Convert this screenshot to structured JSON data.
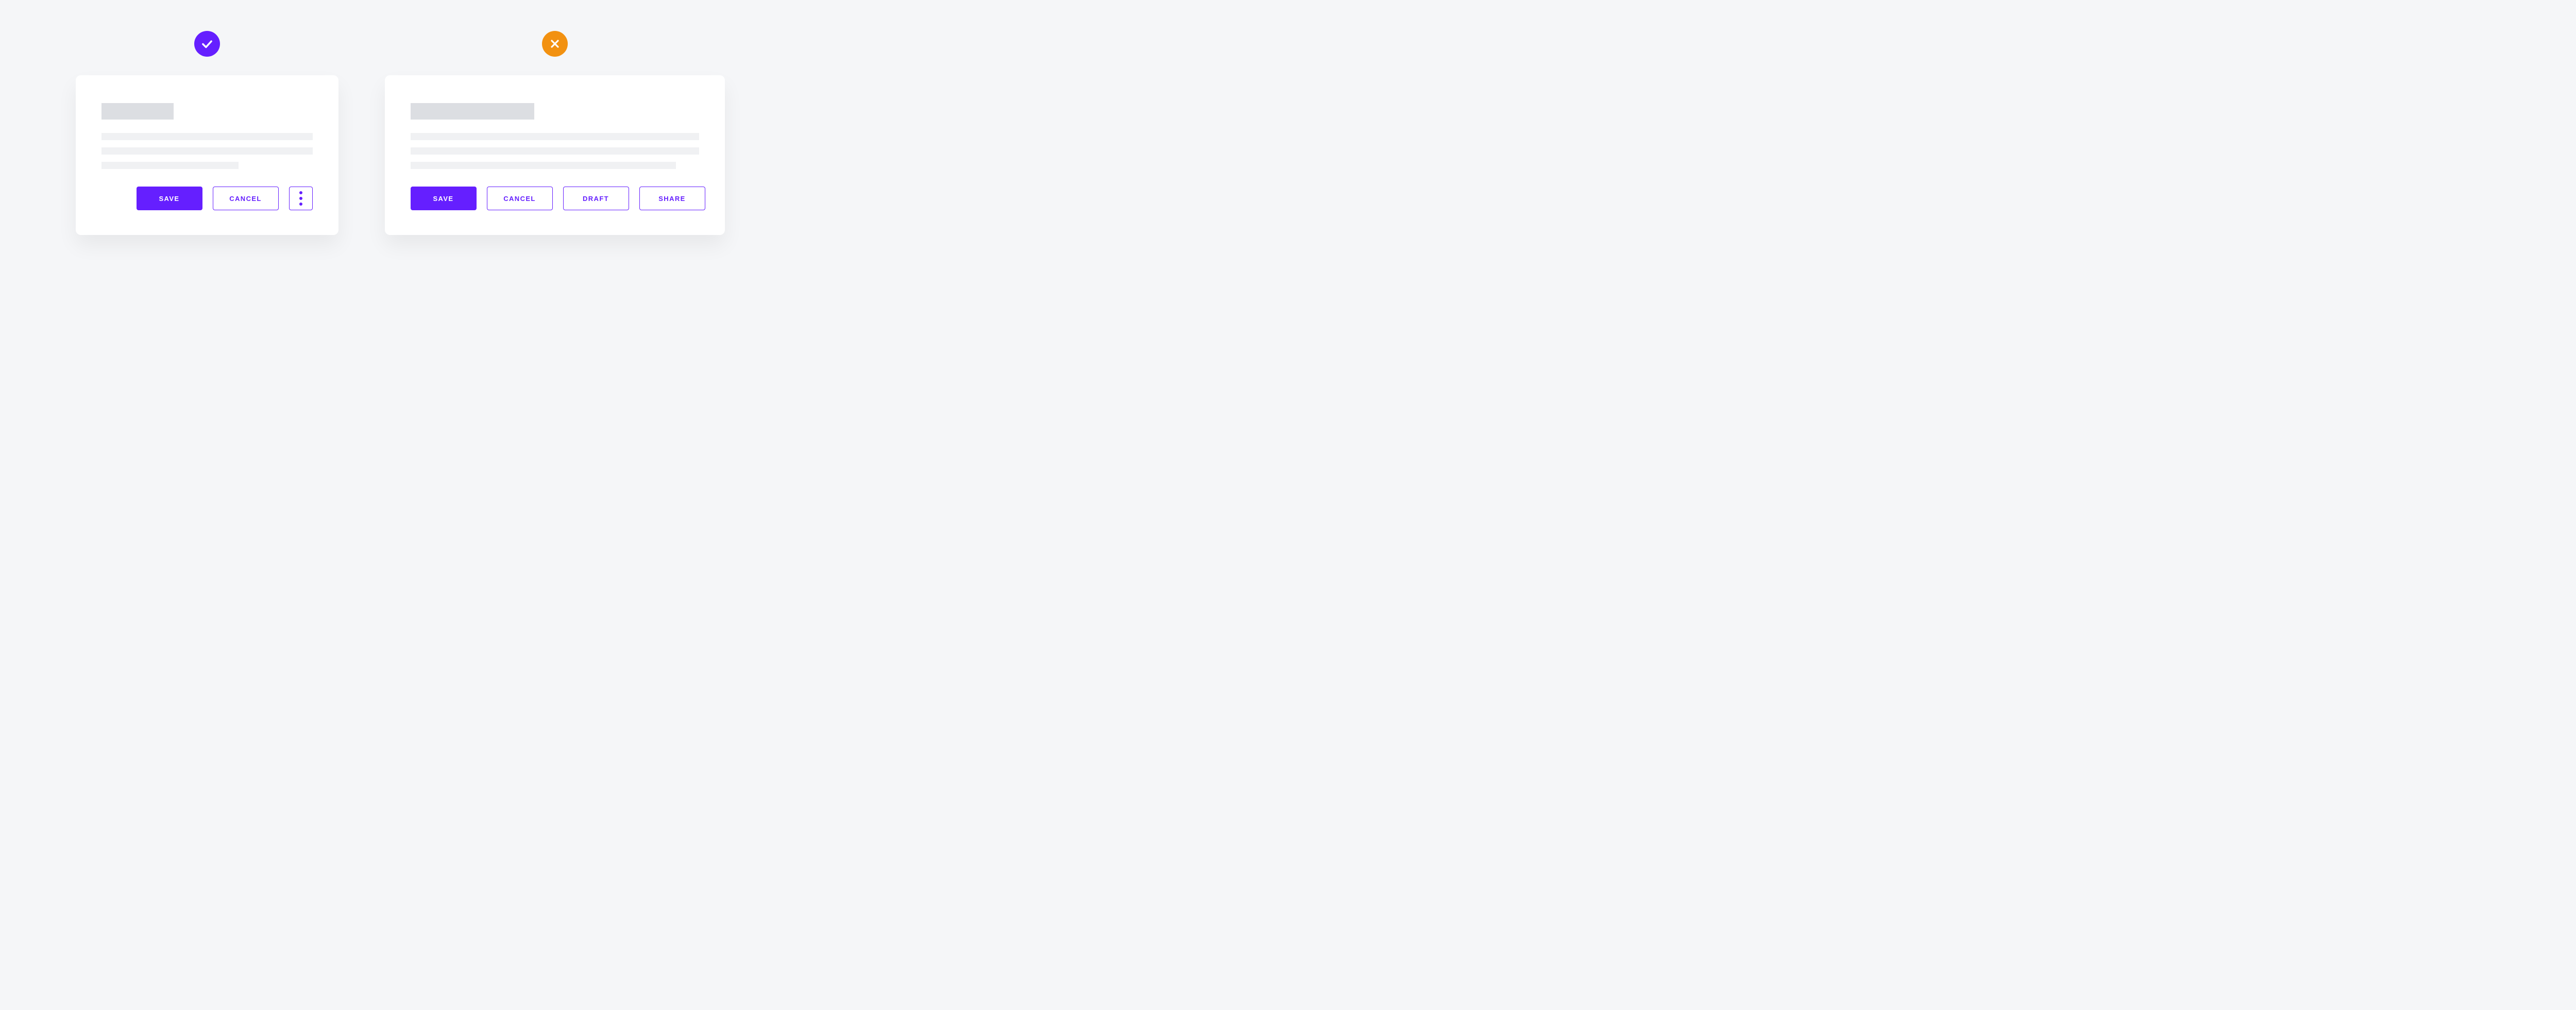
{
  "colors": {
    "accent": "#651fff",
    "do_badge": "#651fff",
    "dont_badge": "#f29111"
  },
  "do": {
    "buttons": {
      "save": "SAVE",
      "cancel": "CANCEL"
    }
  },
  "dont": {
    "buttons": {
      "save": "SAVE",
      "cancel": "CANCEL",
      "draft": "DRAFT",
      "share": "SHARE"
    }
  }
}
